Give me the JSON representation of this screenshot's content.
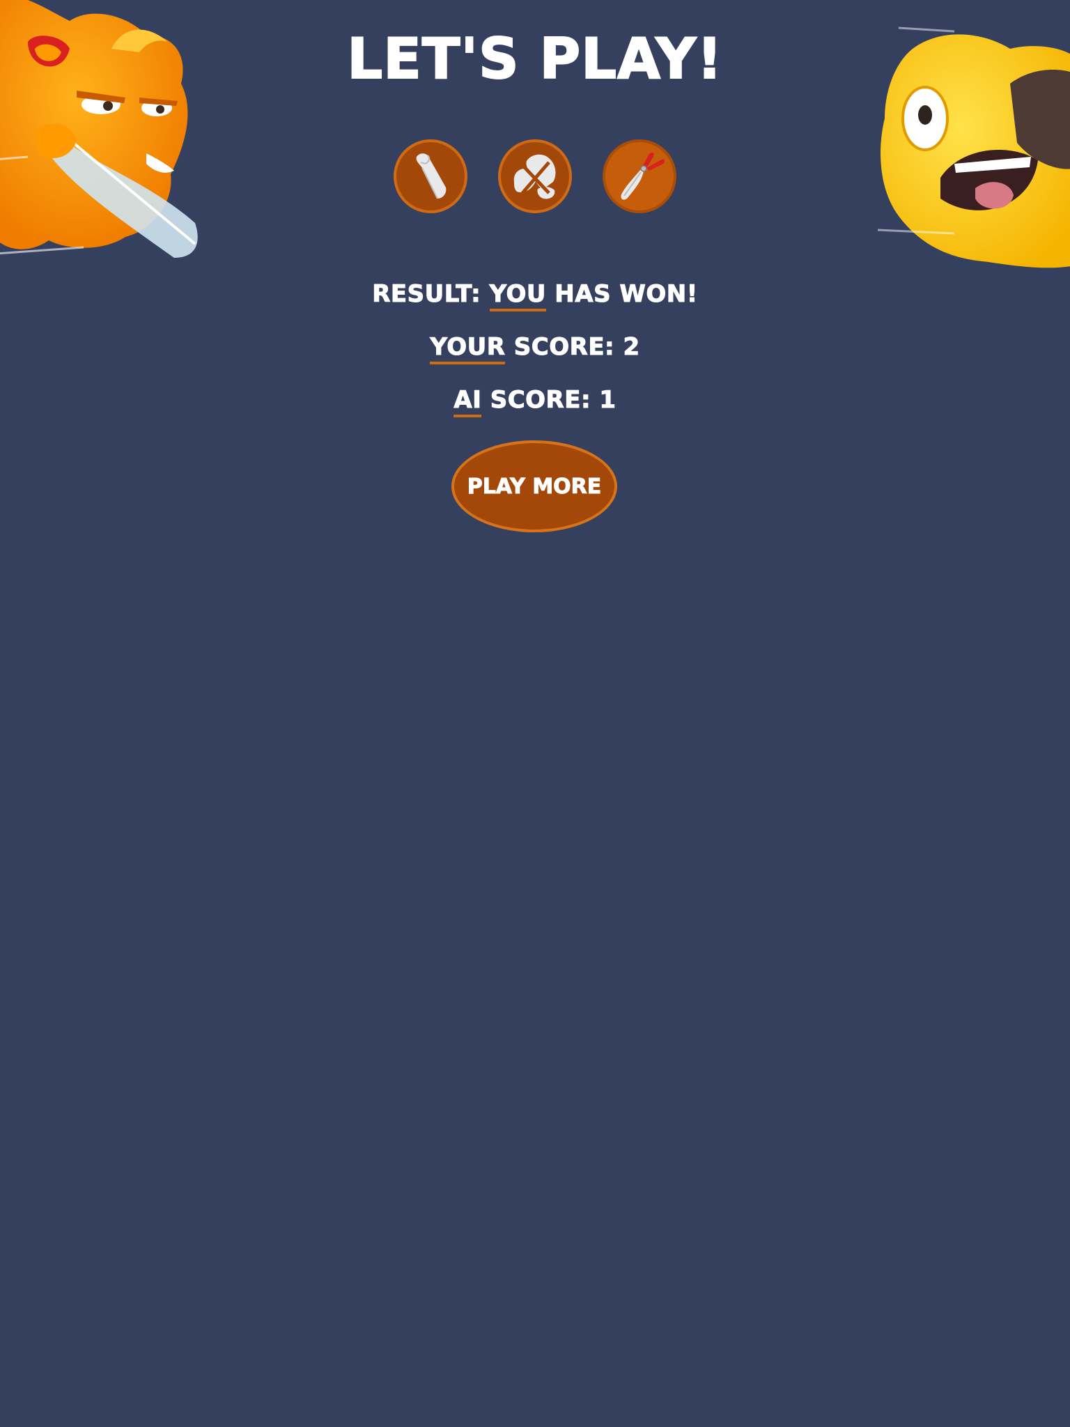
{
  "game": {
    "title": "LET'S PLAY!",
    "choices": [
      {
        "name": "paper",
        "icon": "paper-icon"
      },
      {
        "name": "rock",
        "icon": "rock-icon"
      },
      {
        "name": "scissors",
        "icon": "scissors-icon"
      }
    ],
    "result": {
      "label": "RESULT: ",
      "winner": "YOU",
      "suffix": " HAS WON!"
    },
    "your_score": {
      "label_underlined": "YOUR",
      "label_rest": " SCORE: ",
      "value": "2"
    },
    "ai_score": {
      "label_underlined": "AI",
      "label_rest": " SCORE: ",
      "value": "1"
    },
    "play_more_label": "PLAY MORE"
  },
  "colors": {
    "background": "#353f5e",
    "accent": "#cf6b12",
    "button": "#a4480a",
    "text": "#ffffff"
  },
  "mascots": {
    "left": "orange-monster-with-sword",
    "right": "yellow-scared-monster"
  }
}
